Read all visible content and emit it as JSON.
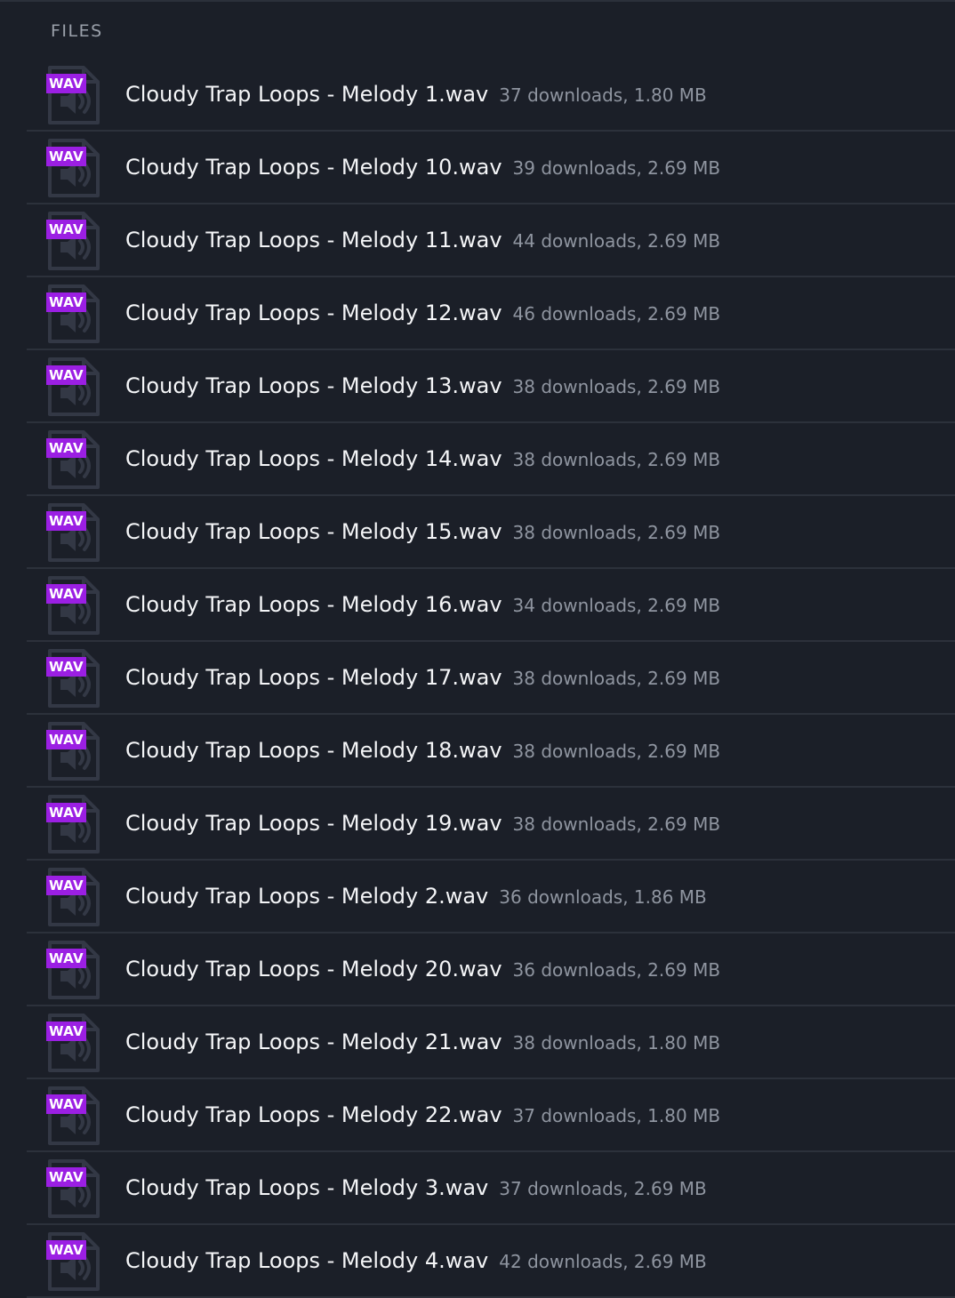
{
  "section": {
    "title": "FILES"
  },
  "colors": {
    "background": "#1b1f28",
    "badge": "#9b1fe3",
    "divider": "#2c313b",
    "meta_text": "#8f95a0"
  },
  "files": [
    {
      "badge": "WAV",
      "icon": "audio-file-icon",
      "name": "Cloudy Trap Loops - Melody 1.wav",
      "meta": "37 downloads, 1.80 MB"
    },
    {
      "badge": "WAV",
      "icon": "audio-file-icon",
      "name": "Cloudy Trap Loops - Melody 10.wav",
      "meta": "39 downloads, 2.69 MB"
    },
    {
      "badge": "WAV",
      "icon": "audio-file-icon",
      "name": "Cloudy Trap Loops - Melody 11.wav",
      "meta": "44 downloads, 2.69 MB"
    },
    {
      "badge": "WAV",
      "icon": "audio-file-icon",
      "name": "Cloudy Trap Loops - Melody 12.wav",
      "meta": "46 downloads, 2.69 MB"
    },
    {
      "badge": "WAV",
      "icon": "audio-file-icon",
      "name": "Cloudy Trap Loops - Melody 13.wav",
      "meta": "38 downloads, 2.69 MB"
    },
    {
      "badge": "WAV",
      "icon": "audio-file-icon",
      "name": "Cloudy Trap Loops - Melody 14.wav",
      "meta": "38 downloads, 2.69 MB"
    },
    {
      "badge": "WAV",
      "icon": "audio-file-icon",
      "name": "Cloudy Trap Loops - Melody 15.wav",
      "meta": "38 downloads, 2.69 MB"
    },
    {
      "badge": "WAV",
      "icon": "audio-file-icon",
      "name": "Cloudy Trap Loops - Melody 16.wav",
      "meta": "34 downloads, 2.69 MB"
    },
    {
      "badge": "WAV",
      "icon": "audio-file-icon",
      "name": "Cloudy Trap Loops - Melody 17.wav",
      "meta": "38 downloads, 2.69 MB"
    },
    {
      "badge": "WAV",
      "icon": "audio-file-icon",
      "name": "Cloudy Trap Loops - Melody 18.wav",
      "meta": "38 downloads, 2.69 MB"
    },
    {
      "badge": "WAV",
      "icon": "audio-file-icon",
      "name": "Cloudy Trap Loops - Melody 19.wav",
      "meta": "38 downloads, 2.69 MB"
    },
    {
      "badge": "WAV",
      "icon": "audio-file-icon",
      "name": "Cloudy Trap Loops - Melody 2.wav",
      "meta": "36 downloads, 1.86 MB"
    },
    {
      "badge": "WAV",
      "icon": "audio-file-icon",
      "name": "Cloudy Trap Loops - Melody 20.wav",
      "meta": "36 downloads, 2.69 MB"
    },
    {
      "badge": "WAV",
      "icon": "audio-file-icon",
      "name": "Cloudy Trap Loops - Melody 21.wav",
      "meta": "38 downloads, 1.80 MB"
    },
    {
      "badge": "WAV",
      "icon": "audio-file-icon",
      "name": "Cloudy Trap Loops - Melody 22.wav",
      "meta": "37 downloads, 1.80 MB"
    },
    {
      "badge": "WAV",
      "icon": "audio-file-icon",
      "name": "Cloudy Trap Loops - Melody 3.wav",
      "meta": "37 downloads, 2.69 MB"
    },
    {
      "badge": "WAV",
      "icon": "audio-file-icon",
      "name": "Cloudy Trap Loops - Melody 4.wav",
      "meta": "42 downloads, 2.69 MB"
    }
  ]
}
